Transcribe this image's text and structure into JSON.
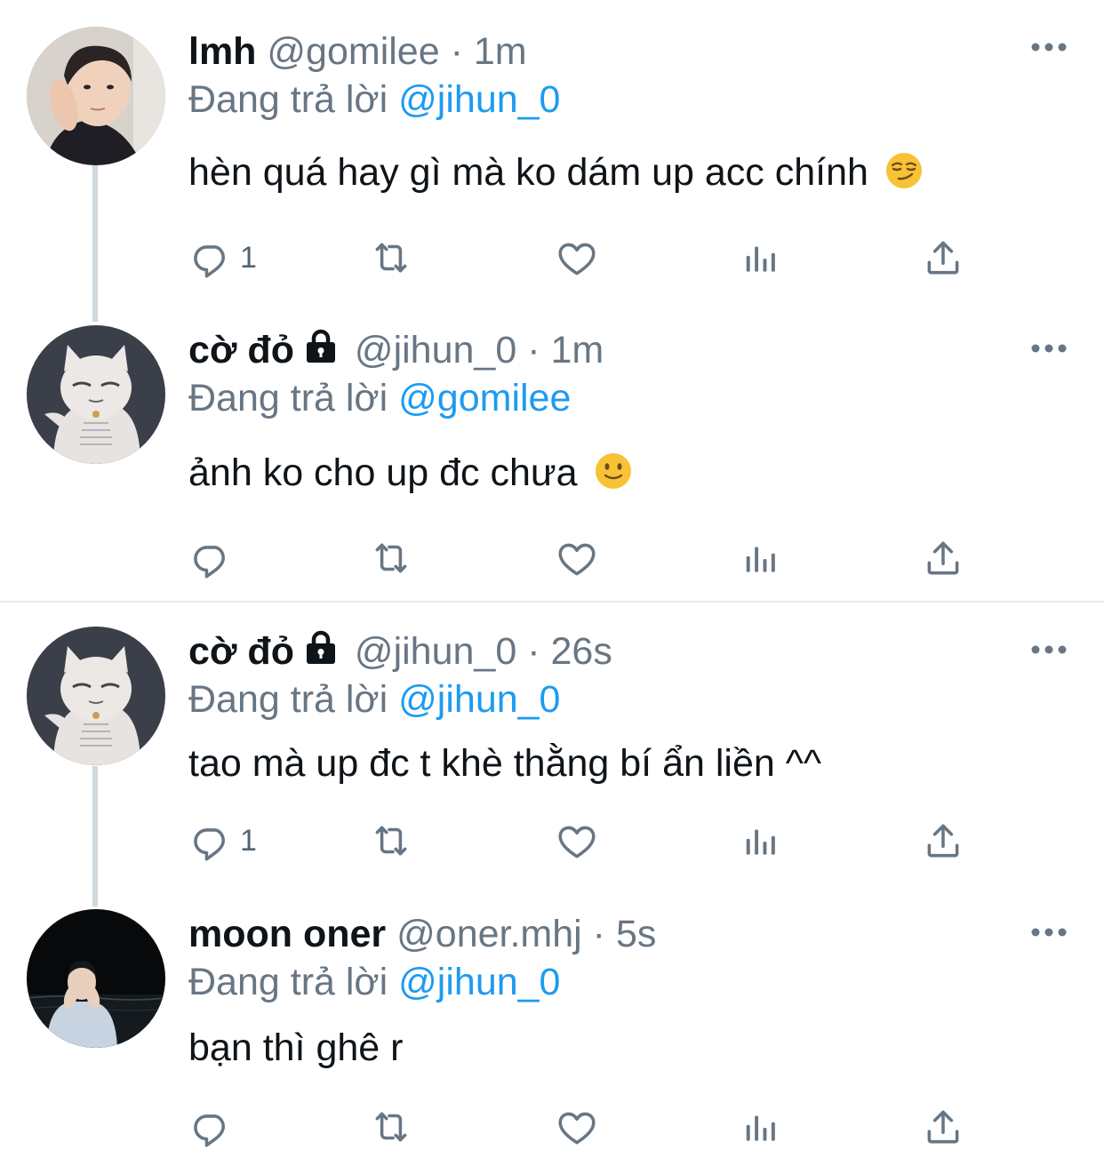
{
  "thread": {
    "tweets": [
      {
        "name": "lmh",
        "handle": "@gomilee",
        "separator": "·",
        "time": "1m",
        "reply_prefix": "Đang trả lời",
        "reply_to": "@jihun_0",
        "text": "hèn quá hay gì mà ko dám up acc chính",
        "emoji": "smirking-face",
        "reply_count": "1",
        "protected": false
      },
      {
        "name": "cờ đỏ",
        "handle": "@jihun_0",
        "separator": "·",
        "time": "1m",
        "reply_prefix": "Đang trả lời",
        "reply_to": "@gomilee",
        "text": "ảnh ko cho up đc chưa",
        "emoji": "slightly-smiling-face",
        "reply_count": "",
        "protected": true
      },
      {
        "name": "cờ đỏ",
        "handle": "@jihun_0",
        "separator": "·",
        "time": "26s",
        "reply_prefix": "Đang trả lời",
        "reply_to": "@jihun_0",
        "text": "tao mà up đc t khè thằng bí ẩn liền ^^",
        "emoji": "",
        "reply_count": "1",
        "protected": true
      },
      {
        "name": "moon oner",
        "handle": "@oner.mhj",
        "separator": "·",
        "time": "5s",
        "reply_prefix": "Đang trả lời",
        "reply_to": "@jihun_0",
        "text": "bạn thì ghê r",
        "emoji": "",
        "reply_count": "",
        "protected": false
      }
    ]
  },
  "icons": {
    "reply": "reply-icon",
    "retweet": "retweet-icon",
    "like": "like-icon",
    "analytics": "analytics-icon",
    "share": "share-icon",
    "more": "more-icon",
    "lock": "lock-icon"
  },
  "colors": {
    "name": "#0f1419",
    "secondary": "#687684",
    "mention": "#1d9bf0",
    "icon": "#687684",
    "divider": "#e6ecf0",
    "thread_line": "#cfd9de"
  }
}
